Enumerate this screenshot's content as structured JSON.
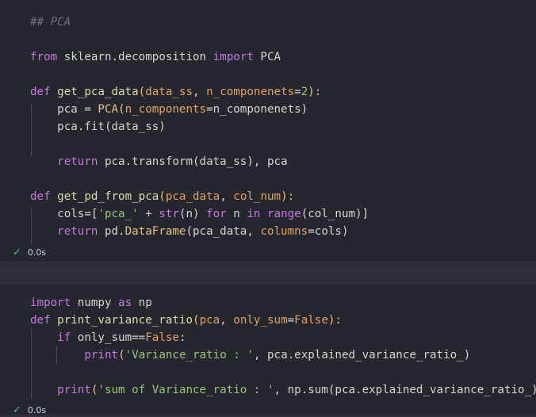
{
  "cell1": {
    "lines": [
      [
        "## PCA"
      ],
      [],
      [
        "from",
        " sklearn.decomposition ",
        "import",
        " PCA"
      ],
      [],
      [
        "def",
        " ",
        "get_pca_data",
        "(",
        "data_ss",
        ", ",
        "n_componenets",
        "=",
        "2",
        "):"
      ],
      [
        "    pca = ",
        "PCA",
        "(",
        "n_components",
        "=n_componenets)"
      ],
      [
        "    pca.",
        "fit",
        "(data_ss)"
      ],
      [],
      [
        "    ",
        "return",
        " pca.",
        "transform",
        "(data_ss), pca"
      ],
      [],
      [
        "def",
        " ",
        "get_pd_from_pca",
        "(",
        "pca_data",
        ", ",
        "col_num",
        "):"
      ],
      [
        "    cols=[",
        "'pca_'",
        " + ",
        "str",
        "(n) ",
        "for",
        " n ",
        "in",
        " ",
        "range",
        "(col_num)]"
      ],
      [
        "    ",
        "return",
        " pd.",
        "DataFrame",
        "(pca_data, ",
        "columns",
        "=cols)"
      ]
    ],
    "status_check": "✓",
    "status_time": "0.0s"
  },
  "cell2": {
    "lines": [
      [
        "import",
        " numpy ",
        "as",
        " np"
      ],
      [
        "def",
        " ",
        "print_variance_ratio",
        "(",
        "pca",
        ", ",
        "only_sum",
        "=",
        "False",
        "):"
      ],
      [
        "    ",
        "if",
        " only_sum==",
        "False",
        ":"
      ],
      [
        "        ",
        "print",
        "(",
        "'Variance_ratio : '",
        ", pca.explained_variance_ratio_)"
      ],
      [],
      [
        "    ",
        "print",
        "(",
        "'sum of Variance_ratio : '",
        ", np.",
        "sum",
        "(pca.explained_variance_ratio_))"
      ]
    ],
    "status_check": "✓",
    "status_time": "0.0s"
  },
  "colors": {
    "keyword": "#c678dd",
    "function": "#dcdcaa",
    "parameter": "#e5a05c",
    "string": "#98c379",
    "comment": "#6a6f7a",
    "default": "#d4d4d4",
    "cell_bg": "#24272d",
    "page_bg": "#2b2f37",
    "check": "#4ec27a"
  }
}
